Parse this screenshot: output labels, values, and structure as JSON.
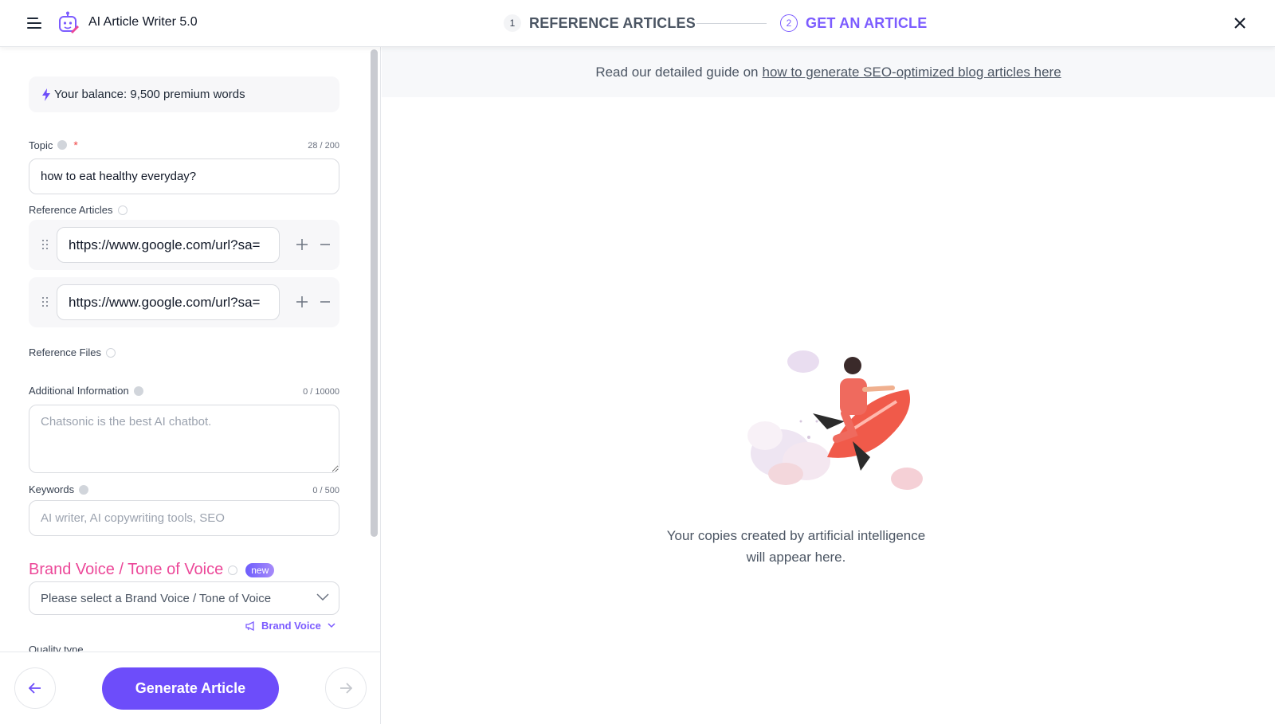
{
  "header": {
    "app_title": "AI Article Writer 5.0",
    "steps": [
      {
        "number": "1",
        "label": "REFERENCE ARTICLES"
      },
      {
        "number": "2",
        "label": "GET AN ARTICLE"
      }
    ],
    "accent_color": "#7c5cff"
  },
  "left": {
    "balance": "Your balance: 9,500 premium words",
    "topic": {
      "label": "Topic",
      "required": "*",
      "counter": "28 / 200",
      "value": "how to eat healthy everyday?"
    },
    "reference_articles": {
      "label": "Reference Articles",
      "urls": [
        "https://www.google.com/url?sa=",
        "https://www.google.com/url?sa="
      ]
    },
    "reference_files": {
      "label": "Reference Files"
    },
    "additional_info": {
      "label": "Additional Information",
      "counter": "0 / 10000",
      "placeholder": "Chatsonic is the best AI chatbot."
    },
    "keywords": {
      "label": "Keywords",
      "counter": "0 / 500",
      "placeholder": "AI writer, AI copywriting tools, SEO"
    },
    "brand_voice": {
      "title": "Brand Voice / Tone of Voice",
      "badge": "new",
      "placeholder": "Please select a Brand Voice / Tone of Voice",
      "link": "Brand Voice",
      "title_color": "#ec4899"
    },
    "quality_label": "Quality type",
    "generate_button": "Generate Article"
  },
  "right": {
    "guide_prefix": "Read our detailed guide on",
    "guide_link": "how to generate SEO-optimized blog articles here",
    "empty_line1": "Your copies created by artificial intelligence",
    "empty_line2": "will appear here."
  }
}
